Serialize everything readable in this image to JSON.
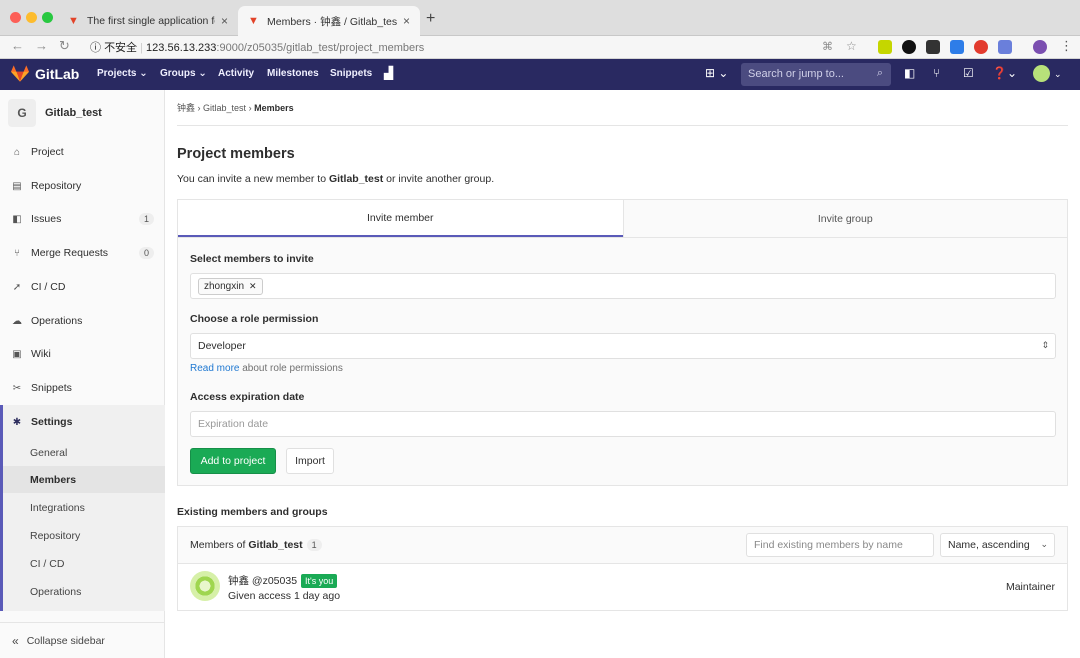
{
  "browser": {
    "tabs": [
      {
        "title": "The first single application for e",
        "active": false
      },
      {
        "title": "Members · 钟鑫 / Gitlab_test · Gi",
        "active": true
      }
    ],
    "url_prefix": "不安全",
    "url_host": "123.56.13.233",
    "url_rest": ":9000/z05035/gitlab_test/project_members",
    "new_tab": "+"
  },
  "nav": {
    "brand": "GitLab",
    "links": [
      "Projects ⌄",
      "Groups ⌄",
      "Activity",
      "Milestones",
      "Snippets"
    ],
    "search_placeholder": "Search or jump to..."
  },
  "sidebar": {
    "project_initial": "G",
    "project_name": "Gitlab_test",
    "items": [
      {
        "label": "Project",
        "icon": "home-icon"
      },
      {
        "label": "Repository",
        "icon": "book-icon"
      },
      {
        "label": "Issues",
        "icon": "issues-icon",
        "count": "1"
      },
      {
        "label": "Merge Requests",
        "icon": "merge-icon",
        "count": "0"
      },
      {
        "label": "CI / CD",
        "icon": "rocket-icon"
      },
      {
        "label": "Operations",
        "icon": "cloud-icon"
      },
      {
        "label": "Wiki",
        "icon": "book-icon"
      },
      {
        "label": "Snippets",
        "icon": "scissors-icon"
      },
      {
        "label": "Settings",
        "icon": "gear-icon"
      }
    ],
    "settings_sub": [
      "General",
      "Members",
      "Integrations",
      "Repository",
      "CI / CD",
      "Operations"
    ],
    "collapse": "Collapse sidebar"
  },
  "breadcrumb": {
    "owner": "钟鑫",
    "project": "Gitlab_test",
    "page": "Members"
  },
  "page": {
    "title": "Project members",
    "lead_pre": "You can invite a new member to ",
    "lead_project": "Gitlab_test",
    "lead_post": " or invite another group."
  },
  "invite": {
    "tab_member": "Invite member",
    "tab_group": "Invite group",
    "select_label": "Select members to invite",
    "selected_user": "zhongxin",
    "role_label": "Choose a role permission",
    "role_value": "Developer",
    "read_more": "Read more",
    "read_more_suffix": " about role permissions",
    "expiry_label": "Access expiration date",
    "expiry_placeholder": "Expiration date",
    "add_button": "Add to project",
    "import_button": "Import"
  },
  "members": {
    "section_title": "Existing members and groups",
    "header_pre": "Members of ",
    "header_project": "Gitlab_test",
    "count": "1",
    "search_placeholder": "Find existing members by name",
    "sort": "Name, ascending",
    "rows": [
      {
        "name": "钟鑫",
        "username": "@z05035",
        "badge": "It's you",
        "access": "Given access 1 day ago",
        "role": "Maintainer"
      }
    ]
  }
}
